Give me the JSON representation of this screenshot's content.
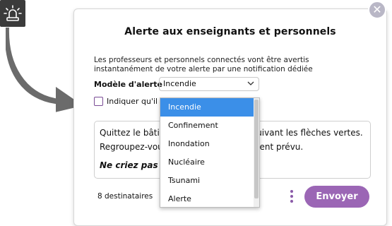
{
  "dialog": {
    "title": "Alerte aux enseignants et personnels",
    "description_line1": "Les professeurs et personnels connectés vont être avertis",
    "description_line2": "instantanément de votre alerte par une notification dédiée",
    "model_label": "Modèle d'alerte",
    "selected_model": "Incendie",
    "checkbox_label": "Indiquer qu'il",
    "message_line1": "Quittez le bâtim",
    "message_line1_tail": "uivant les flèches vertes.",
    "message_line2": "Regroupez-vou",
    "message_line2_tail": "ement prévu.",
    "message_line3": "Ne criez pas -",
    "recipients": "8 destinataires",
    "send_label": "Envoyer",
    "close_glyph": "✕"
  },
  "dropdown": {
    "options": [
      "Incendie",
      "Confinement",
      "Inondation",
      "Nucléaire",
      "Tsunami",
      "Alerte"
    ],
    "active_index": 0
  },
  "colors": {
    "accent": "#9b66b5",
    "selected_option": "#3b8fe8",
    "arrow": "#6b6b6b",
    "icon_bg": "#3b3b3b"
  },
  "icons": {
    "alert_icon": "alarm-siren-icon",
    "close_icon": "close-icon",
    "chevron": "chevron-down-icon",
    "more": "kebab-menu-icon"
  }
}
